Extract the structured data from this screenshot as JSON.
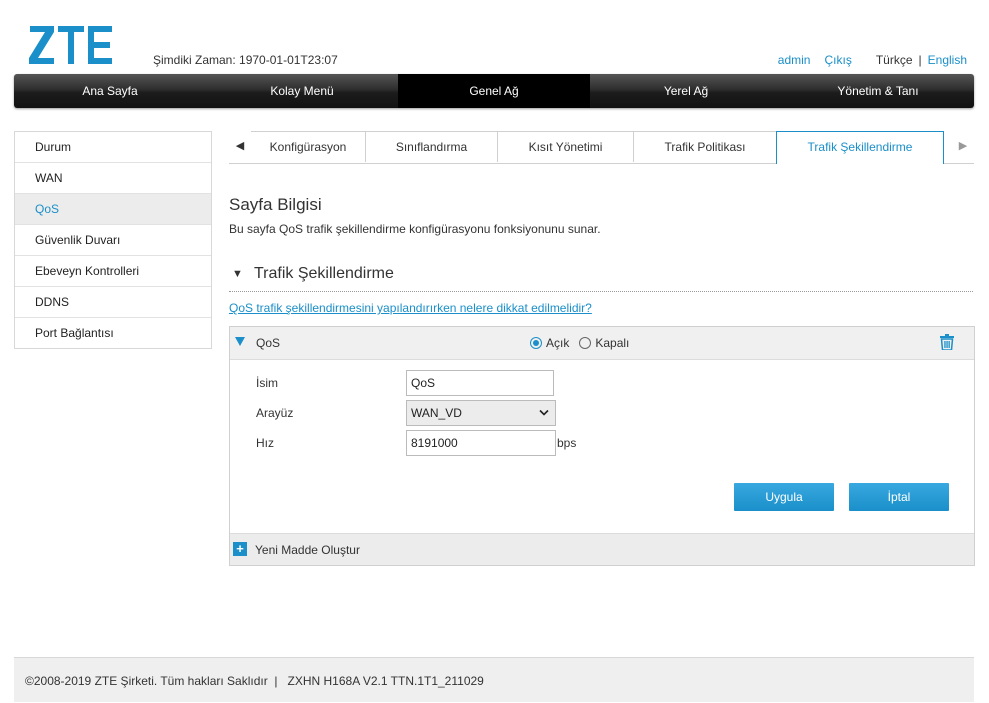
{
  "brand": {
    "logo_text": "ZTE",
    "color": "#1a8fc9"
  },
  "header": {
    "clock_label": "Şimdiki Zaman:",
    "clock_value": "1970-01-01T23:07",
    "user": "admin",
    "logout": "Çıkış",
    "lang_current": "Türkçe",
    "lang_separator": "|",
    "lang_other": "English"
  },
  "main_nav": [
    {
      "label": "Ana Sayfa",
      "active": false
    },
    {
      "label": "Kolay Menü",
      "active": false
    },
    {
      "label": "Genel Ağ",
      "active": true
    },
    {
      "label": "Yerel Ağ",
      "active": false
    },
    {
      "label": "Yönetim & Tanı",
      "active": false
    }
  ],
  "sidebar": {
    "items": [
      {
        "label": "Durum",
        "active": false
      },
      {
        "label": "WAN",
        "active": false
      },
      {
        "label": "QoS",
        "active": true
      },
      {
        "label": "Güvenlik Duvarı",
        "active": false
      },
      {
        "label": "Ebeveyn Kontrolleri",
        "active": false
      },
      {
        "label": "DDNS",
        "active": false
      },
      {
        "label": "Port Bağlantısı",
        "active": false
      }
    ]
  },
  "tabs": {
    "left_arrow": "◀",
    "right_arrow": "▶",
    "items": [
      {
        "label": "Konfigürasyon",
        "active": false
      },
      {
        "label": "Sınıflandırma",
        "active": false
      },
      {
        "label": "Kısıt Yönetimi",
        "active": false
      },
      {
        "label": "Trafik Politikası",
        "active": false
      },
      {
        "label": "Trafik Şekillendirme",
        "active": true
      }
    ]
  },
  "page_info": {
    "title": "Sayfa Bilgisi",
    "description": "Bu sayfa QoS trafik şekillendirme konfigürasyonu fonksiyonunu sunar."
  },
  "section": {
    "toggle_glyph": "▼",
    "title": "Trafik Şekillendirme",
    "help_link": "QoS trafik şekillendirmesini yapılandırırken nelere dikkat edilmelidir?"
  },
  "entry": {
    "name": "QoS",
    "radio_on_label": "Açık",
    "radio_off_label": "Kapalı",
    "selected": "on",
    "fields": {
      "name_label": "İsim",
      "name_value": "QoS",
      "interface_label": "Arayüz",
      "interface_value": "WAN_VD",
      "rate_label": "Hız",
      "rate_value": "8191000",
      "rate_unit": "bps"
    },
    "apply_label": "Uygula",
    "cancel_label": "İptal"
  },
  "new_item": {
    "icon": "+",
    "label": "Yeni Madde Oluştur"
  },
  "footer": {
    "text": "©2008-2019 ZTE Şirketi. Tüm hakları Saklıdır  |   ZXHN H168A V2.1 TTN.1T1_211029"
  }
}
